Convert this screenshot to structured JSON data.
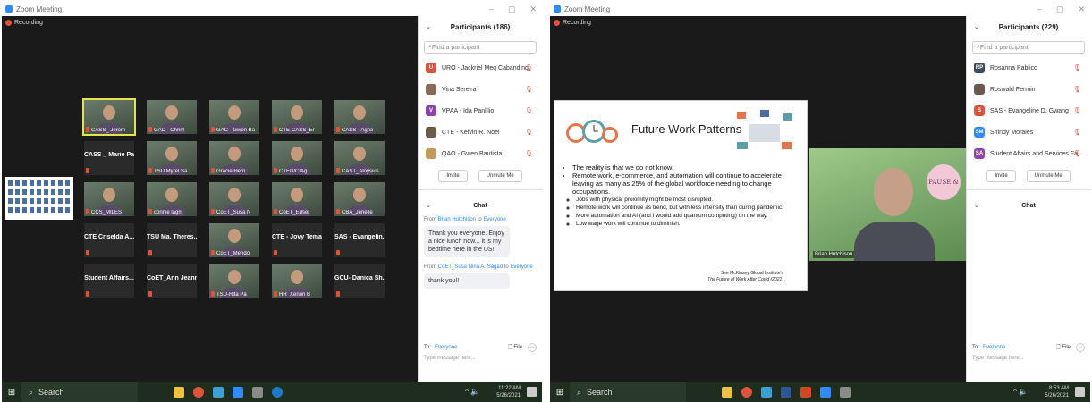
{
  "left": {
    "window_title": "Zoom Meeting",
    "recording": "Recording",
    "tiles": [
      {
        "name": "CASS_ Jerom",
        "type": "video",
        "active": true
      },
      {
        "name": "GAD - Christ",
        "type": "video"
      },
      {
        "name": "GAC - Gwen Ba",
        "type": "video"
      },
      {
        "name": "CTE-CASS_Er",
        "type": "video"
      },
      {
        "name": "CASS - Agna",
        "type": "video"
      },
      {
        "name": "CASS _ Marie Pa...",
        "type": "name"
      },
      {
        "name": "TSU Myrel Sa",
        "type": "video"
      },
      {
        "name": "Gracie Hern",
        "type": "video"
      },
      {
        "name": "CTED/CIAg",
        "type": "video"
      },
      {
        "name": "CAST_Aloysius",
        "type": "video"
      },
      {
        "name": "CCS_MILES",
        "type": "video"
      },
      {
        "name": "connie lagm",
        "type": "video"
      },
      {
        "name": "CoET_Susa N",
        "type": "video"
      },
      {
        "name": "CoET_Edsel",
        "type": "video"
      },
      {
        "name": "CBA_Jenelle",
        "type": "video"
      },
      {
        "name": "CTE Criselda A...",
        "type": "name"
      },
      {
        "name": "TSU Ma. Theres...",
        "type": "name"
      },
      {
        "name": "CoET_Mendo",
        "type": "video"
      },
      {
        "name": "CTE - Jovy Temas",
        "type": "name"
      },
      {
        "name": "SAS - Evangelin...",
        "type": "name"
      },
      {
        "name": "Student Affairs...",
        "type": "name"
      },
      {
        "name": "CoET_Ann Jeann...",
        "type": "name"
      },
      {
        "name": "TSU-Rita Pa",
        "type": "video"
      },
      {
        "name": "HR_Xenon B",
        "type": "video"
      },
      {
        "name": "GCU- Danica Sh...",
        "type": "name"
      }
    ],
    "panel": {
      "participants_title": "Participants (186)",
      "search_placeholder": "Find a participant",
      "participants": [
        {
          "initial": "U",
          "color": "#e0533b",
          "name": "URO - Jackriel Meg Cabanding"
        },
        {
          "initial": "",
          "color": "#8a6b5a",
          "name": "Vina Sereira"
        },
        {
          "initial": "V",
          "color": "#8e44ad",
          "name": "VPAA - Ida Panlilio"
        },
        {
          "initial": "",
          "color": "#6b5a4a",
          "name": "CTE - Kelvin R. Noel"
        },
        {
          "initial": "",
          "color": "#c39b5a",
          "name": "QAO - Gwen Bautista"
        }
      ],
      "invite": "Invite",
      "unmute": "Unmute Me",
      "chat_title": "Chat",
      "messages": [
        {
          "from": "Brian Hutchison",
          "to": "Everyone",
          "text": "Thank you everyone. Enjoy a nice lunch now... it is my bedtime here in the US!!"
        },
        {
          "from": "CoET_Susa Nina A. Sagad",
          "to": "Everyone",
          "text": "thank you!!"
        }
      ],
      "to_label": "To:",
      "to_value": "Everyone",
      "file_label": "File",
      "input_placeholder": "Type message here..."
    },
    "taskbar": {
      "search": "Search",
      "time": "11:22 AM",
      "date": "5/26/2021"
    }
  },
  "right": {
    "window_title": "Zoom Meeting",
    "recording": "Recording",
    "slide": {
      "title": "Future Work Patterns",
      "bullets": [
        "The reality is that we do not know.",
        "Remote work, e-commerce, and automation will continue to accelerate leaving as many as 25% of the global workforce needing to change occupations."
      ],
      "sub_bullets": [
        "Jobs with physical proximity might be most disrupted.",
        "Remote work will continue as trend, but with less intensity than during pandemic.",
        "More automation and AI (and I would add quantum computing) on the way.",
        "Low wage work will continue to diminish."
      ],
      "source_1": "See McKinsey Global Institute's",
      "source_2": "The Future of Work After Covid (2021)"
    },
    "speaker_name": "Brian Hutchison",
    "speaker_badge": "PAUSE &",
    "panel": {
      "participants_title": "Participants (229)",
      "search_placeholder": "Find a participant",
      "participants": [
        {
          "initial": "RP",
          "color": "#3a4a5a",
          "name": "Rosanna Pablico"
        },
        {
          "initial": "",
          "color": "#6b5a4a",
          "name": "Roswald Fermin"
        },
        {
          "initial": "S",
          "color": "#e0533b",
          "name": "SAS - Evangeline D. Gwang"
        },
        {
          "initial": "SM",
          "color": "#2d8cff",
          "name": "Shindy Morales"
        },
        {
          "initial": "SA",
          "color": "#8e44ad",
          "name": "Student Affairs and Services Fa..."
        }
      ],
      "invite": "Invite",
      "unmute": "Unmute Me",
      "chat_title": "Chat",
      "to_label": "To:",
      "to_value": "Everyone",
      "file_label": "File",
      "input_placeholder": "Type message here..."
    },
    "taskbar": {
      "search": "Search",
      "time": "8:53 AM",
      "date": "5/26/2021"
    }
  }
}
